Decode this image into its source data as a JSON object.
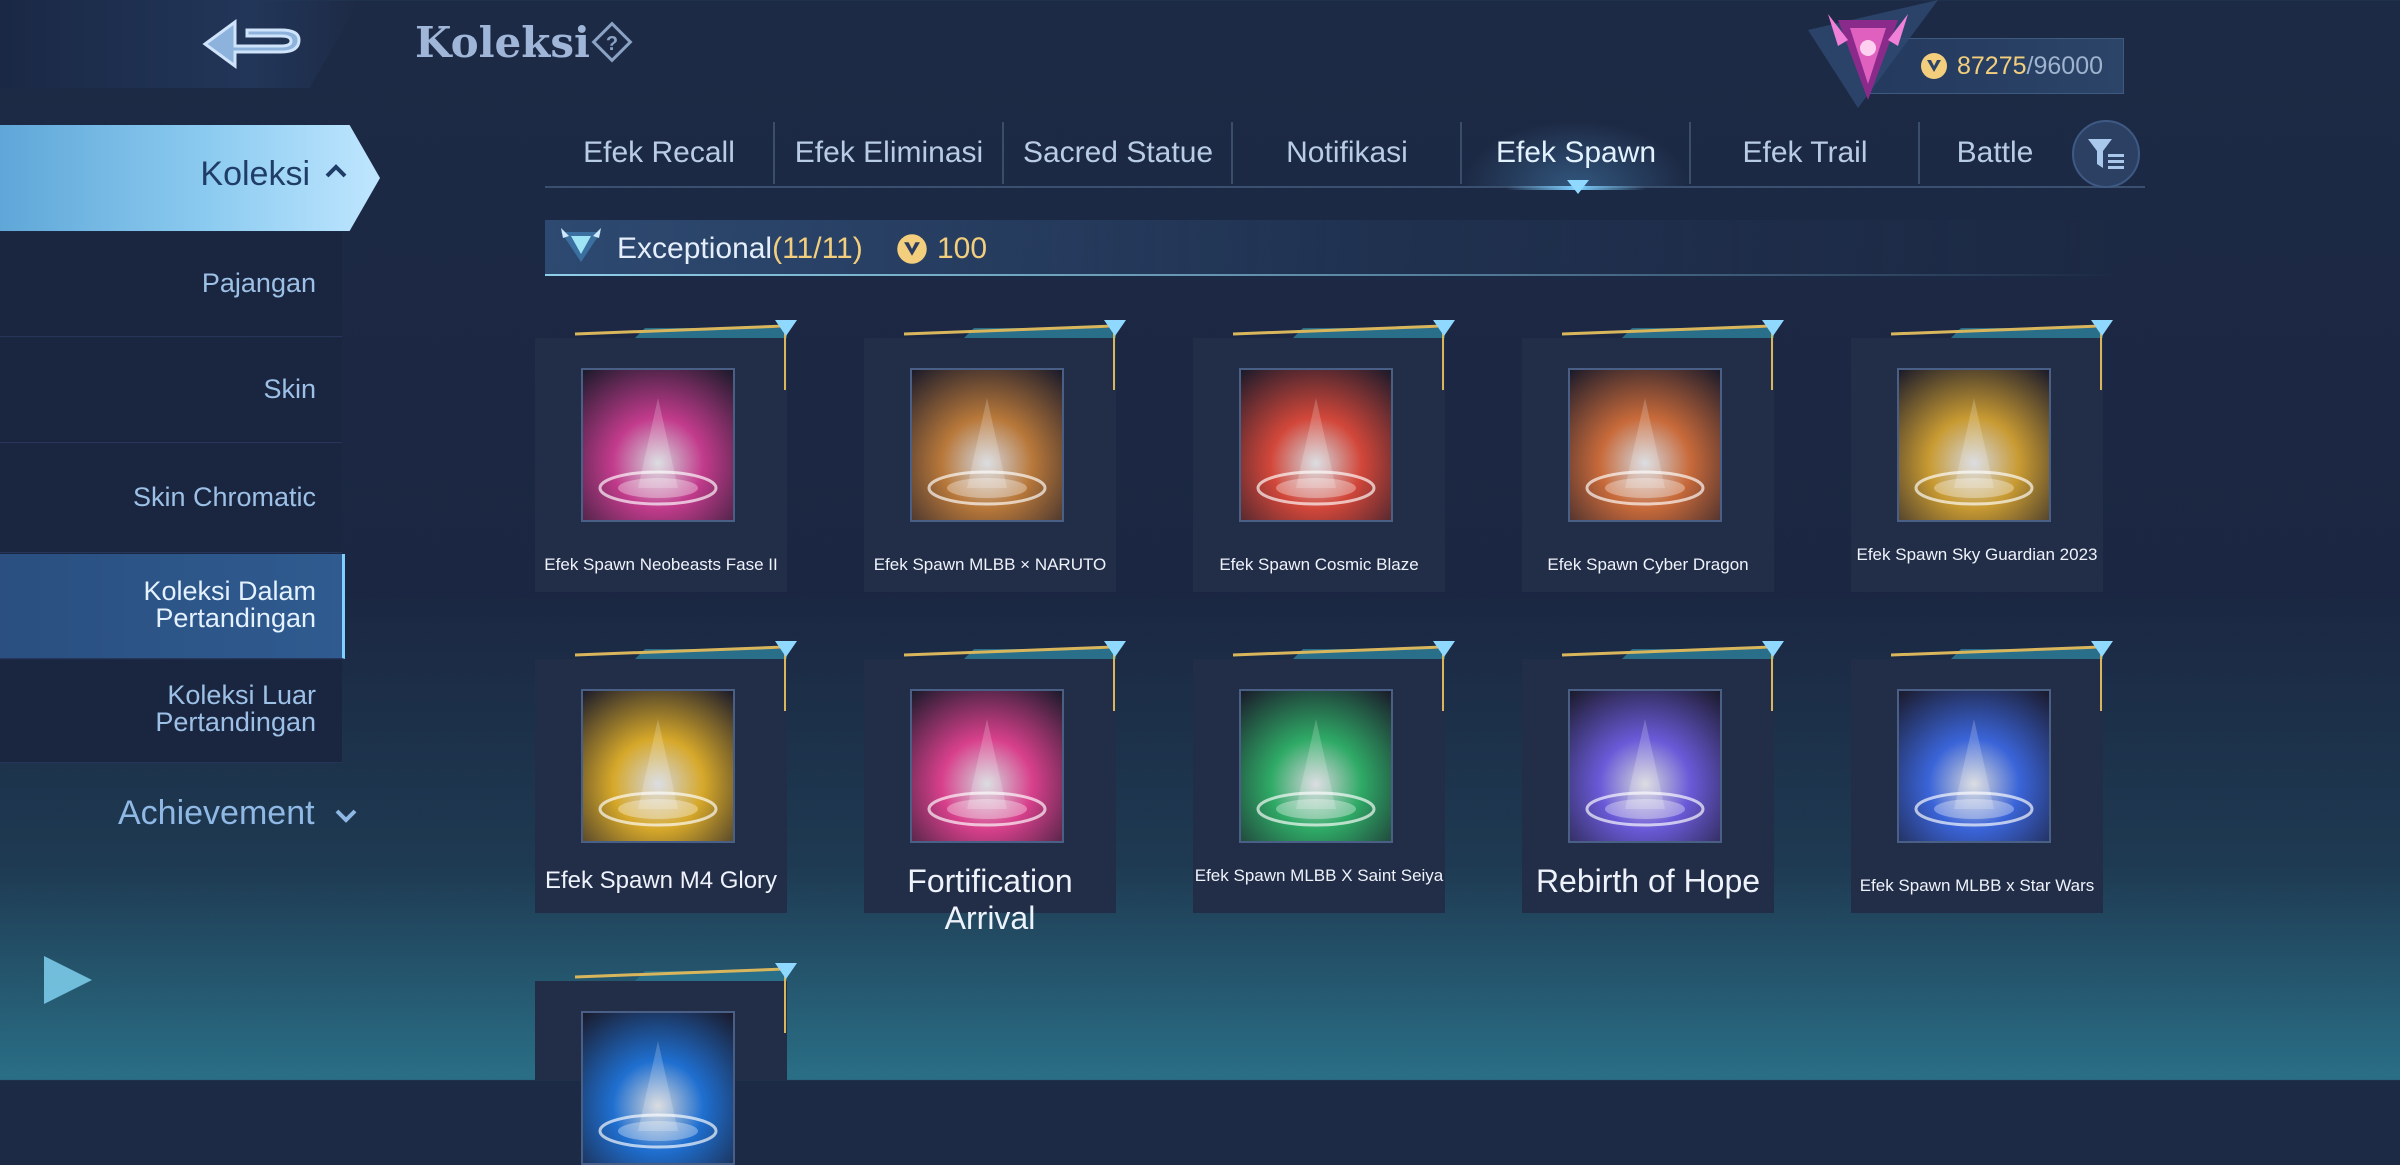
{
  "header": {
    "title": "Koleksi",
    "back_icon": "back-arrow-icon",
    "help_icon": "question-icon"
  },
  "currency": {
    "value": "87275",
    "max": "/96000",
    "icon": "coin-icon"
  },
  "sidebar": {
    "active_label": "Koleksi",
    "items": [
      {
        "label": "Pajangan"
      },
      {
        "label": "Skin"
      },
      {
        "label": "Skin Chromatic"
      },
      {
        "label": "Koleksi Dalam\nPertandingan"
      },
      {
        "label": "Koleksi Luar\nPertandingan"
      }
    ],
    "achievement_label": "Achievement"
  },
  "tabs": [
    {
      "label": "Efek Recall"
    },
    {
      "label": "Efek Eliminasi"
    },
    {
      "label": "Sacred Statue"
    },
    {
      "label": "Notifikasi"
    },
    {
      "label": "Efek Spawn"
    },
    {
      "label": "Efek Trail"
    },
    {
      "label": "Battle"
    }
  ],
  "active_tab": "Efek Spawn",
  "section": {
    "title": "Exceptional",
    "count": "(11/11)",
    "price": "100"
  },
  "cards": [
    {
      "name": "Efek Spawn Neobeasts Fase II",
      "theme": "#c23b8c"
    },
    {
      "name": "Efek Spawn MLBB × NARUTO",
      "theme": "#b8783a"
    },
    {
      "name": "Efek Spawn Cosmic Blaze",
      "theme": "#d2473a"
    },
    {
      "name": "Efek Spawn Cyber Dragon",
      "theme": "#c86a3a"
    },
    {
      "name": "Efek Spawn Sky Guardian 2023",
      "theme": "#c89a32"
    },
    {
      "name": "Efek Spawn M4 Glory",
      "theme": "#d6a82a"
    },
    {
      "name": "Fortification Arrival",
      "theme": "#d8408c"
    },
    {
      "name": "Efek Spawn MLBB X Saint Seiya",
      "theme": "#2faa66"
    },
    {
      "name": "Rebirth of Hope",
      "theme": "#6a5ad8"
    },
    {
      "name": "Efek Spawn MLBB x Star Wars",
      "theme": "#3a64d8"
    },
    {
      "name": "",
      "theme": "#1f6fd0"
    }
  ]
}
